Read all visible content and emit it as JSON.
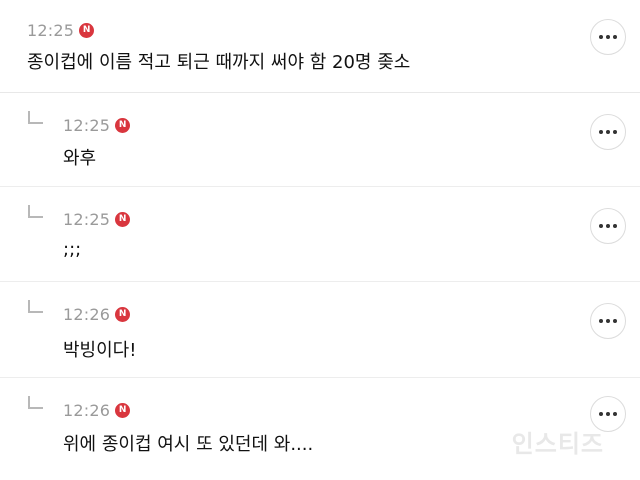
{
  "comments": [
    {
      "time": "12:25",
      "badge": "N",
      "text": "종이컵에 이름 적고 퇴근 때까지 써야 함 20명 좆소",
      "reply": false
    },
    {
      "time": "12:25",
      "badge": "N",
      "text": "와후",
      "reply": true
    },
    {
      "time": "12:25",
      "badge": "N",
      "text": ";;;",
      "reply": true
    },
    {
      "time": "12:26",
      "badge": "N",
      "text": "박빙이다!",
      "reply": true
    },
    {
      "time": "12:26",
      "badge": "N",
      "text": "위에 종이컵 여시 또 있던데 와....",
      "reply": true
    }
  ],
  "watermark": "인스티즈"
}
